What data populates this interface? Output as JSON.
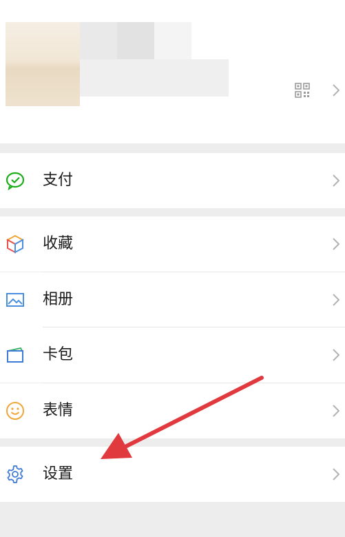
{
  "menu": {
    "pay": "支付",
    "favorites": "收藏",
    "album": "相册",
    "cards": "卡包",
    "stickers": "表情",
    "settings": "设置"
  },
  "colors": {
    "accent_arrow": "#e0393e",
    "pay_icon": "#1aad19",
    "settings_icon": "#3e7bd6"
  },
  "icons": {
    "pay": "wechat-pay-icon",
    "favorites": "cube-icon",
    "album": "picture-icon",
    "cards": "card-wallet-icon",
    "stickers": "smiley-icon",
    "settings": "gear-icon",
    "qr": "qr-code-icon",
    "chevron": "chevron-right-icon"
  }
}
